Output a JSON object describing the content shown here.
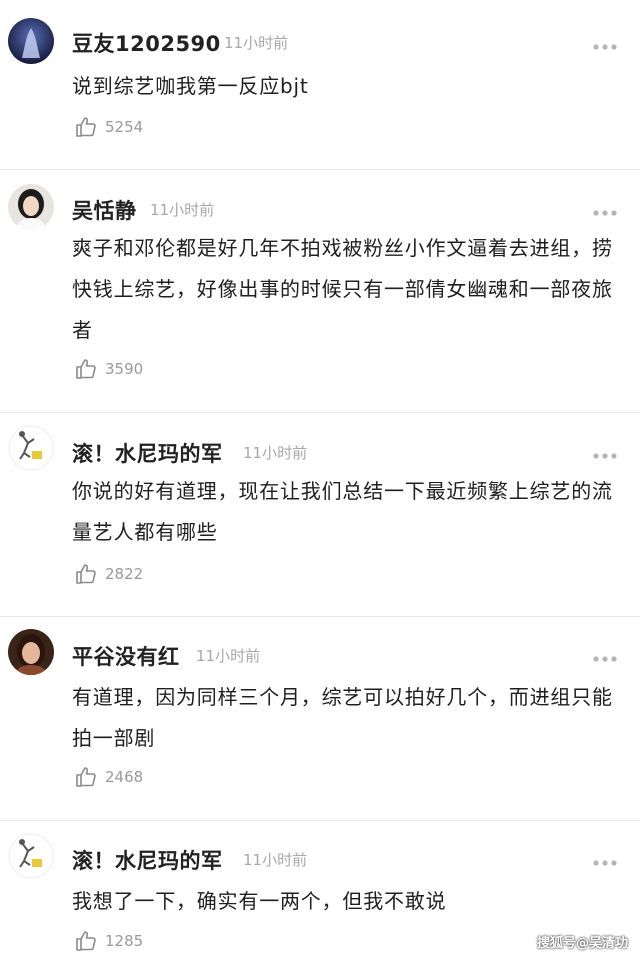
{
  "comments": [
    {
      "username": "豆友1202590",
      "time": "11小时前",
      "text": "说到综艺咖我第一反应bjt",
      "likes": "5254"
    },
    {
      "username": "吴恬静",
      "time": "11小时前",
      "text": "爽子和邓伦都是好几年不拍戏被粉丝小作文逼着去进组，捞快钱上综艺，好像出事的时候只有一部倩女幽魂和一部夜旅者",
      "likes": "3590"
    },
    {
      "username": "滚！水尼玛的军",
      "time": "11小时前",
      "text": "你说的好有道理，现在让我们总结一下最近频繁上综艺的流量艺人都有哪些",
      "likes": "2822"
    },
    {
      "username": "平谷没有红",
      "time": "11小时前",
      "text": "有道理，因为同样三个月，综艺可以拍好几个，而进组只能拍一部剧",
      "likes": "2468"
    },
    {
      "username": "滚！水尼玛的军",
      "time": "11小时前",
      "text": "我想了一下，确实有一两个，但我不敢说",
      "likes": "1285"
    }
  ],
  "watermark": "搜狐号@吴清功",
  "icons": {
    "like": "thumbs-up-icon",
    "more": "more-dots-icon"
  },
  "colors": {
    "text": "#1f1f1f",
    "meta": "#a8a8a8",
    "divider": "#e9e9e9"
  }
}
